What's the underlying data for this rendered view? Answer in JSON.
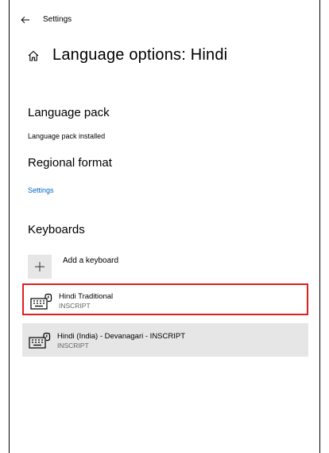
{
  "window": {
    "title": "Settings"
  },
  "header": {
    "title": "Language options: Hindi"
  },
  "language_pack": {
    "heading": "Language pack",
    "status": "Language pack installed"
  },
  "regional_format": {
    "heading": "Regional format",
    "link": "Settings"
  },
  "keyboards": {
    "heading": "Keyboards",
    "add_label": "Add a keyboard",
    "items": [
      {
        "name": "Hindi Traditional",
        "layout": "INSCRIPT",
        "state": "selected"
      },
      {
        "name": "Hindi (India) - Devanagari - INSCRIPT",
        "layout": "INSCRIPT",
        "state": "hover"
      }
    ]
  },
  "colors": {
    "accent_link": "#0067c0",
    "selection_outline": "#e01e1e",
    "hover_bg": "#e6e6e6"
  },
  "icons": {
    "back": "arrow-left-icon",
    "home": "home-icon",
    "add": "plus-icon",
    "keyboard": "keyboard-icon"
  }
}
